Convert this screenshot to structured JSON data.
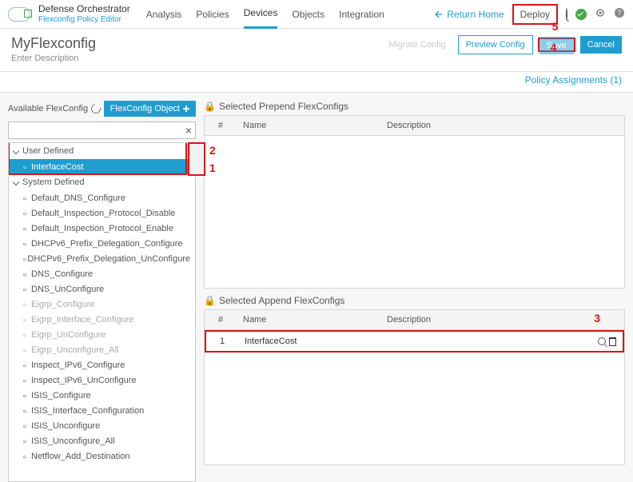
{
  "top": {
    "brand_name": "Defense Orchestrator",
    "brand_sub": "Flexconfig Policy Editor",
    "nav": [
      "Analysis",
      "Policies",
      "Devices",
      "Objects",
      "Integration"
    ],
    "active_nav_index": 2,
    "return_home": "Return Home",
    "deploy": "Deploy"
  },
  "header": {
    "title": "MyFlexconfig",
    "subtitle": "Enter Description",
    "migrate": "Migrate Config",
    "preview": "Preview Config",
    "save": "Save",
    "cancel": "Cancel",
    "assignments": "Policy Assignments (1)"
  },
  "sidebar": {
    "avail_label": "Available FlexConfig",
    "fc_btn": "FlexConfig Object",
    "groups": {
      "user": {
        "label": "User Defined",
        "items": [
          "InterfaceCost"
        ]
      },
      "system": {
        "label": "System Defined",
        "items": [
          {
            "name": "Default_DNS_Configure",
            "dis": false
          },
          {
            "name": "Default_Inspection_Protocol_Disable",
            "dis": false
          },
          {
            "name": "Default_Inspection_Protocol_Enable",
            "dis": false
          },
          {
            "name": "DHCPv6_Prefix_Delegation_Configure",
            "dis": false
          },
          {
            "name": "DHCPv6_Prefix_Delegation_UnConfigure",
            "dis": false
          },
          {
            "name": "DNS_Configure",
            "dis": false
          },
          {
            "name": "DNS_UnConfigure",
            "dis": false
          },
          {
            "name": "Eigrp_Configure",
            "dis": true
          },
          {
            "name": "Eigrp_Interface_Configure",
            "dis": true
          },
          {
            "name": "Eigrp_UnConfigure",
            "dis": true
          },
          {
            "name": "Eigrp_Unconfigure_All",
            "dis": true
          },
          {
            "name": "Inspect_IPv6_Configure",
            "dis": false
          },
          {
            "name": "Inspect_IPv6_UnConfigure",
            "dis": false
          },
          {
            "name": "ISIS_Configure",
            "dis": false
          },
          {
            "name": "ISIS_Interface_Configuration",
            "dis": false
          },
          {
            "name": "ISIS_Unconfigure",
            "dis": false
          },
          {
            "name": "ISIS_Unconfigure_All",
            "dis": false
          },
          {
            "name": "Netflow_Add_Destination",
            "dis": false
          }
        ]
      }
    }
  },
  "panels": {
    "prepend_title": "Selected Prepend FlexConfigs",
    "append_title": "Selected Append FlexConfigs",
    "col_num": "#",
    "col_name": "Name",
    "col_desc": "Description",
    "append_rows": [
      {
        "num": "1",
        "name": "InterfaceCost",
        "desc": ""
      }
    ]
  },
  "callouts": {
    "c1": "1",
    "c2": "2",
    "c3": "3",
    "c4": "4",
    "c5": "5"
  }
}
